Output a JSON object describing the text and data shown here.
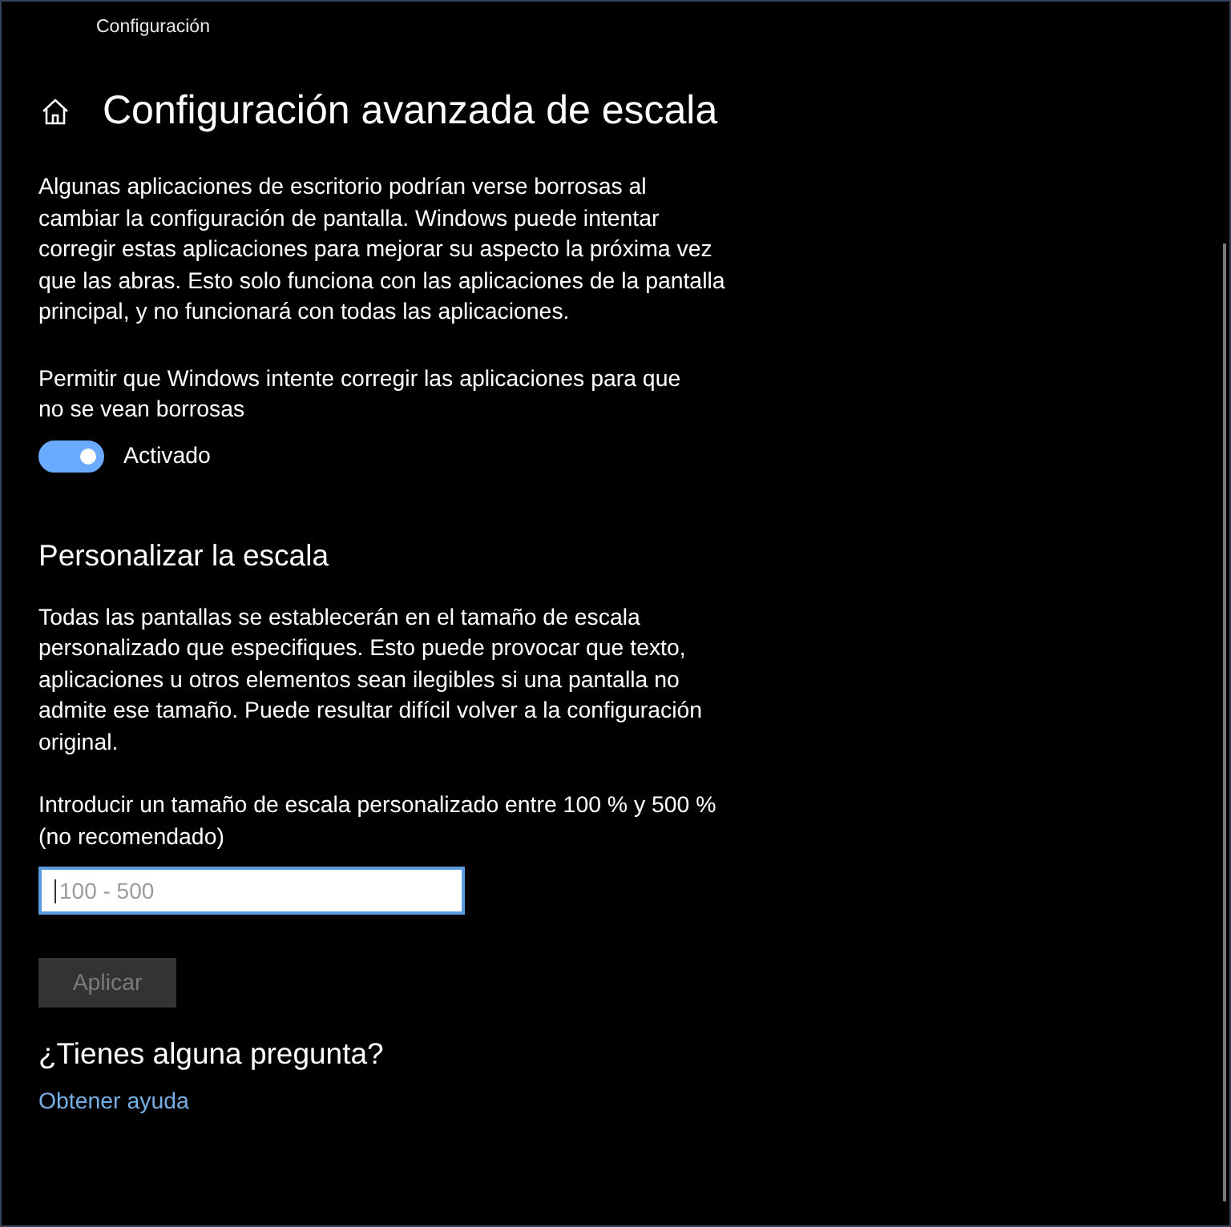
{
  "window": {
    "title": "Configuración"
  },
  "header": {
    "title": "Configuración avanzada de escala"
  },
  "fix_blurry": {
    "description": "Algunas aplicaciones de escritorio podrían verse borrosas al cambiar la configuración de pantalla. Windows puede intentar corregir estas aplicaciones para mejorar su aspecto la próxima vez que las abras. Esto solo funciona con las aplicaciones de la pantalla principal, y no funcionará con todas las aplicaciones.",
    "toggle": {
      "label": "Permitir que Windows intente corregir las aplicaciones para que no se vean borrosas",
      "on": true,
      "state_text": "Activado"
    }
  },
  "custom_scaling": {
    "title": "Personalizar la escala",
    "description": "Todas las pantallas se establecerán en el tamaño de escala personalizado que especifiques. Esto puede provocar que texto, aplicaciones u otros elementos sean ilegibles si una pantalla no admite ese tamaño. Puede resultar difícil volver a la configuración original.",
    "field": {
      "label": "Introducir un tamaño de escala personalizado entre 100 % y 500 % (no recomendado)",
      "placeholder": "100 - 500",
      "focused": true
    },
    "apply_button": {
      "label": "Aplicar",
      "disabled": true
    }
  },
  "help": {
    "title": "¿Tienes alguna pregunta?",
    "link": "Obtener ayuda"
  }
}
